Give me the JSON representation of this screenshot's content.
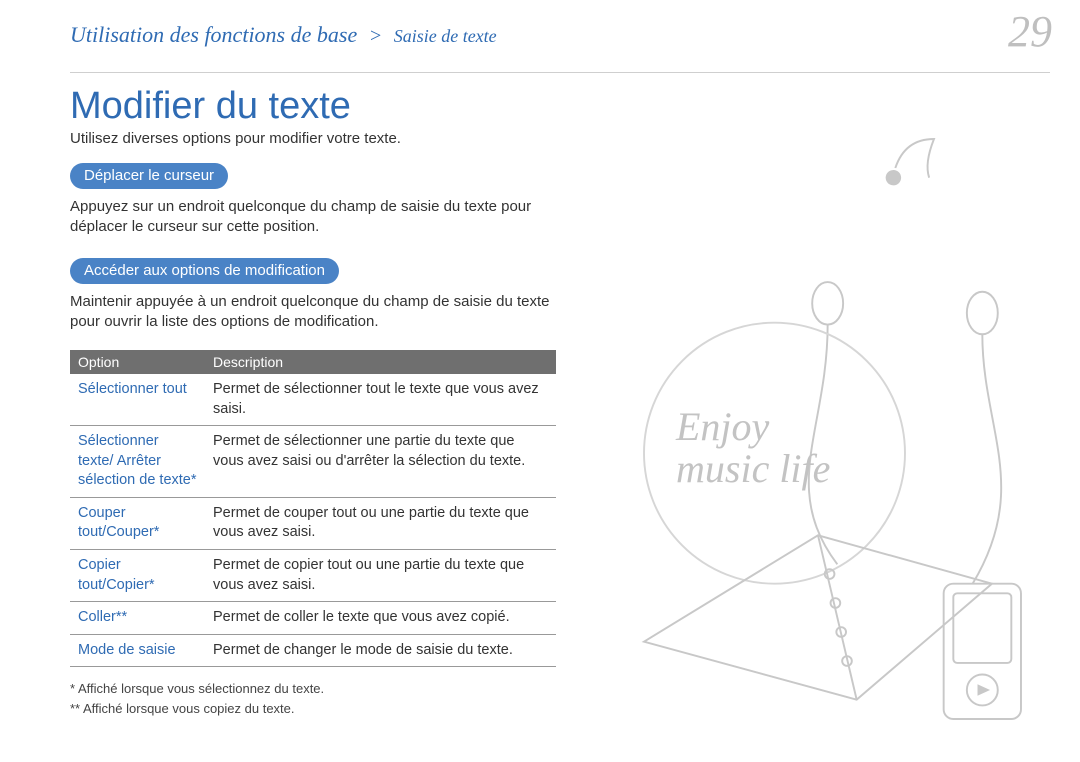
{
  "header": {
    "breadcrumb_main": "Utilisation des fonctions de base",
    "breadcrumb_sep": ">",
    "breadcrumb_sub": "Saisie de texte",
    "page_number": "29"
  },
  "main": {
    "title": "Modifier du texte",
    "intro": "Utilisez diverses options pour modifier votre texte.",
    "sections": [
      {
        "label": "Déplacer le curseur",
        "body": "Appuyez sur un endroit quelconque du champ de saisie du texte pour déplacer le curseur sur cette position."
      },
      {
        "label": "Accéder aux options de modification",
        "body": "Maintenir appuyée à un endroit quelconque du champ de saisie du texte pour ouvrir la liste des options de modification."
      }
    ],
    "table": {
      "headers": [
        "Option",
        "Description"
      ],
      "rows": [
        {
          "option": "Sélectionner tout",
          "description": "Permet de sélectionner tout le texte que vous avez saisi."
        },
        {
          "option": "Sélectionner texte/\nArrêter sélection de texte*",
          "description": "Permet de sélectionner une partie du texte que vous avez saisi ou d'arrêter la sélection du texte."
        },
        {
          "option": "Couper tout/Couper*",
          "description": "Permet de couper tout ou une partie du texte que vous avez saisi."
        },
        {
          "option": "Copier tout/Copier*",
          "description": "Permet de copier tout ou une partie du texte que vous avez saisi."
        },
        {
          "option": "Coller**",
          "description": "Permet de coller le texte que vous avez copié."
        },
        {
          "option": "Mode de saisie",
          "description": "Permet de changer le mode de saisie du texte."
        }
      ]
    },
    "notes": [
      "* Affiché lorsque vous sélectionnez du texte.",
      "** Affiché lorsque vous copiez du texte."
    ]
  },
  "illustration": {
    "tagline_line1": "Enjoy",
    "tagline_line2": "music life"
  }
}
